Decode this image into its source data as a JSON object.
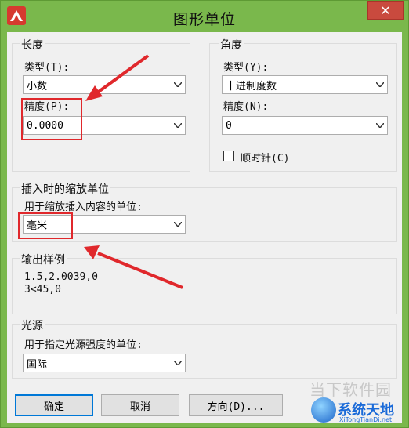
{
  "window": {
    "title": "图形单位",
    "close_glyph": "✕"
  },
  "length": {
    "group_label": "长度",
    "type_label": "类型(T):",
    "type_value": "小数",
    "precision_label": "精度(P):",
    "precision_value": "0.0000"
  },
  "angle": {
    "group_label": "角度",
    "type_label": "类型(Y):",
    "type_value": "十进制度数",
    "precision_label": "精度(N):",
    "precision_value": "0",
    "clockwise_label": "顺时针(C)",
    "clockwise_checked": false
  },
  "insertion": {
    "group_label": "插入时的缩放单位",
    "units_label": "用于缩放插入内容的单位:",
    "units_value": "毫米"
  },
  "sample": {
    "group_label": "输出样例",
    "line1": "1.5,2.0039,0",
    "line2": "3<45,0"
  },
  "lighting": {
    "group_label": "光源",
    "units_label": "用于指定光源强度的单位:",
    "units_value": "国际"
  },
  "buttons": {
    "ok": "确定",
    "cancel": "取消",
    "direction": "方向(D)..."
  },
  "watermark": {
    "text1": "当下软件园",
    "text2": "系统天地",
    "text3": "XiTongTianDi.net"
  },
  "colors": {
    "annotation": "#e0282c",
    "accent": "#0078d7",
    "titlebar": "#7ab84c"
  }
}
